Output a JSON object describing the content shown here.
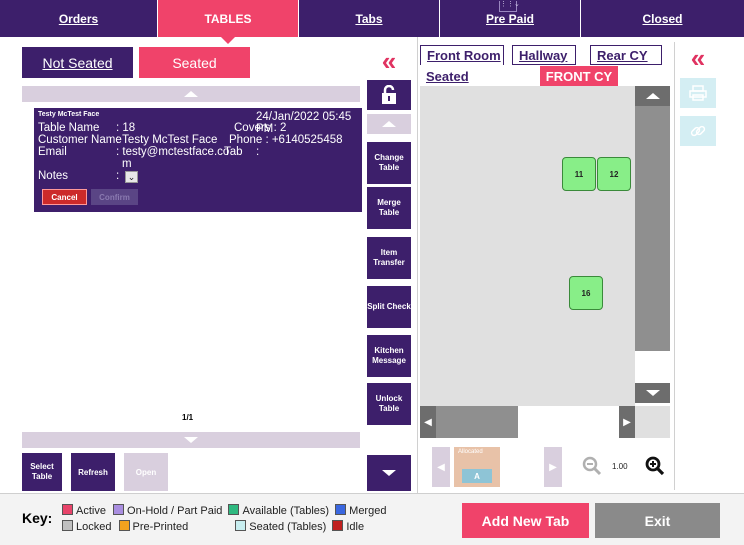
{
  "nav": {
    "tabs": [
      {
        "label": "Orders",
        "active": false
      },
      {
        "label": "TABLES",
        "active": true
      },
      {
        "label": "Tabs",
        "active": false
      },
      {
        "label": "Pre Paid",
        "active": false
      },
      {
        "label": "Closed",
        "active": false
      }
    ]
  },
  "seating": {
    "not_seated_label": "Not Seated",
    "seated_label": "Seated"
  },
  "card": {
    "name": "Testy McTest Face",
    "datetime": "24/Jan/2022 05:45 PM",
    "table_name_label": "Table Name",
    "table_name_value": ": 18",
    "covers_label": "Covers : 2",
    "customer_name_label": "Customer Name",
    "customer_name_value": ": Testy McTest Face",
    "phone_label": "Phone : +6140525458",
    "email_label": "Email",
    "email_value": ": testy@mctestface.co",
    "email_value_wrap": "m",
    "tab_label": "Tab",
    "tab_value": ":",
    "notes_label": "Notes",
    "notes_value": ":",
    "cancel_label": "Cancel",
    "confirm_label": "Confirm"
  },
  "pagination": "1/1",
  "bottom_buttons": {
    "select_table": "Select Table",
    "refresh": "Refresh",
    "open": "Open"
  },
  "actions": {
    "change_table": "Change Table",
    "merge_table": "Merge Table",
    "item_transfer": "Item Transfer",
    "split_check": "Split Check",
    "kitchen_message": "Kitchen Message",
    "unlock_table": "Unlock Table"
  },
  "rooms": {
    "front_room": "Front Room",
    "hallway": "Hallway",
    "rear_cy": "Rear CY",
    "seated": "Seated",
    "front_cy": "FRONT CY"
  },
  "tables": [
    "11",
    "12",
    "16"
  ],
  "allocated_label": "Allocated",
  "allocated_letter": "A",
  "zoom_level": "1.00",
  "key": {
    "title": "Key:",
    "items": [
      {
        "label": "Active",
        "color": "#e8446a"
      },
      {
        "label": "On-Hold / Part Paid",
        "color": "#a98ee0"
      },
      {
        "label": "Available (Tables)",
        "color": "#2fb980"
      },
      {
        "label": "Merged",
        "color": "#3a67e0"
      },
      {
        "label": "Locked",
        "color": "#c0c0c0"
      },
      {
        "label": "Pre-Printed",
        "color": "#f3a21e"
      },
      {
        "label": "Seated (Tables)",
        "color": "#c8eef0"
      },
      {
        "label": "Idle",
        "color": "#c0201f"
      }
    ]
  },
  "footer_buttons": {
    "add_new_tab": "Add New Tab",
    "exit": "Exit"
  },
  "colors": {
    "purple": "#3d1f6b",
    "pink": "#f0436a",
    "light_purple": "#d9cfde",
    "floor": "#e0e0e0",
    "table_green": "#88ee88"
  }
}
